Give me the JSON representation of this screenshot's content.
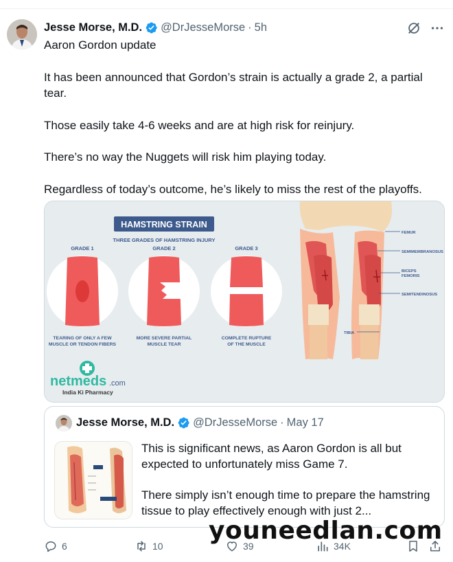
{
  "author": {
    "name": "Jesse Morse, M.D.",
    "handle": "@DrJesseMorse",
    "separator": "·",
    "time": "5h"
  },
  "tweet": {
    "paragraphs": [
      "Aaron Gordon update",
      "It has been announced that Gordon’s strain is actually a grade 2, a partial tear.",
      "Those easily take 4-6 weeks and are at high risk for reinjury.",
      "There’s no way the Nuggets will risk him playing today.",
      "Regardless of today’s outcome, he’s likely to miss the rest of the playoffs."
    ]
  },
  "media": {
    "title": "HAMSTRING STRAIN",
    "subtitle": "THREE GRADES OF HAMSTRING INJURY",
    "grades": [
      {
        "label": "GRADE 1",
        "caption_line1": "TEARING OF ONLY A FEW",
        "caption_line2": "MUSCLE OR TENDON FIBERS"
      },
      {
        "label": "GRADE 2",
        "caption_line1": "MORE SEVERE PARTIAL",
        "caption_line2": "MUSCLE TEAR"
      },
      {
        "label": "GRADE 3",
        "caption_line1": "COMPLETE RUPTURE",
        "caption_line2": "OF THE MUSCLE"
      }
    ],
    "anatomy_labels": {
      "femur": "FEMUR",
      "semimembranosus": "SEMIMEMBRANOSUS",
      "biceps1": "BICEPS",
      "biceps2": "FEMORIS",
      "semitendinosus": "SEMITENDINOSUS",
      "tibia": "TIBIA"
    },
    "brand": "netmeds",
    "brand_suffix": ".com",
    "brand_tagline": "India Ki Pharmacy"
  },
  "quote": {
    "name": "Jesse Morse, M.D.",
    "handle": "@DrJesseMorse",
    "separator": "·",
    "date": "May 17",
    "text1": "This is significant news, as Aaron Gordon is all but expected to unfortunately miss Game 7.",
    "text2": "There simply isn’t enough time to prepare the hamstring tissue to play effectively enough with just 2..."
  },
  "actions": {
    "replies": "6",
    "retweets": "10",
    "likes": "39",
    "views": "34K"
  },
  "watermark": "youneedlan.com",
  "colors": {
    "verified": "#1d9bf0",
    "muscle": "#ef5b5b",
    "title_bg": "#3d5a8c",
    "brand_green": "#2fb9a1"
  }
}
